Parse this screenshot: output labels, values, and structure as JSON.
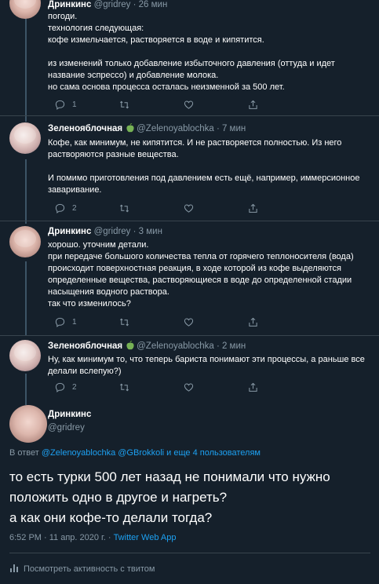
{
  "tweets": [
    {
      "name": "Дринкинс",
      "handle": "@gridrey · 26 мин",
      "text": "погоди.\nтехнология следующая:\nкофе измельчается, растворяется в воде и кипятится.\n\nиз изменений только добавление избыточного давления (оттуда и идет название эспрессо) и добавление молока.\nно сама основа процесса осталась неизменной за 500 лет.",
      "reply_count": "1",
      "green": false
    },
    {
      "name": "Зеленояблочная",
      "handle": "@Zelenoyablochka · 7 мин",
      "text": "Кофе, как минимум, не кипятится. И не растворяется полностью. Из него растворяются разные вещества.\n\nИ помимо приготовления под давлением есть ещё, например, иммерсионное заваривание.",
      "reply_count": "2",
      "green": true
    },
    {
      "name": "Дринкинс",
      "handle": "@gridrey · 3 мин",
      "text": "хорошо. уточним детали.\nпри передаче большого количества тепла от горячего теплоносителя (вода) происходит поверхностная реакция, в ходе которой из кофе выделяются определенные вещества, растворяющиеся в воде до определенной стадии насыщения водного раствора.\nтак что изменилось?",
      "reply_count": "1",
      "green": false
    },
    {
      "name": "Зеленояблочная",
      "handle": "@Zelenoyablochka · 2 мин",
      "text": "Ну, как минимум то, что теперь бариста понимают эти процессы, а раньше все делали вслепую?)",
      "reply_count": "2",
      "green": true
    }
  ],
  "main": {
    "name": "Дринкинс",
    "handle": "@gridrey",
    "reply_prefix": "В ответ ",
    "reply_users": "@Zelenoyablochka @GBrokkoli и еще 4 пользователям",
    "text": "то есть турки 500 лет назад не понимали что нужно положить одно в другое и нагреть?\nа как они кофе-то делали тогда?",
    "time": "6:52 PM · 11 апр. 2020 г. · ",
    "app": "Twitter Web App",
    "activity": "Посмотреть активность с твитом"
  },
  "colors": {
    "background": "#15202b",
    "link": "#1da1f2",
    "muted": "#8899a6",
    "green_apple": "#77b255"
  }
}
